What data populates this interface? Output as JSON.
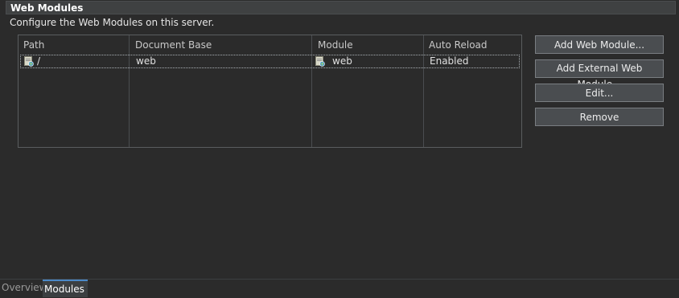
{
  "section": {
    "title": "Web Modules",
    "description": "Configure the Web Modules on this server."
  },
  "table": {
    "columns": [
      "Path",
      "Document Base",
      "Module",
      "Auto Reload"
    ],
    "rows": [
      {
        "path": "/",
        "document_base": "web",
        "module": "web",
        "auto_reload": "Enabled"
      }
    ]
  },
  "buttons": {
    "add": "Add Web Module...",
    "add_external": "Add External Web Module...",
    "edit": "Edit...",
    "remove": "Remove"
  },
  "tabs": [
    {
      "label": "Overview",
      "active": false
    },
    {
      "label": "Modules",
      "active": true
    }
  ],
  "colors": {
    "background": "#2b2b2b",
    "header": "#3f4142",
    "button": "#4a4d50",
    "active_tab_accent": "#4a88c7"
  },
  "icons": {
    "path_icon": "web-module-icon",
    "module_icon": "web-module-icon"
  }
}
